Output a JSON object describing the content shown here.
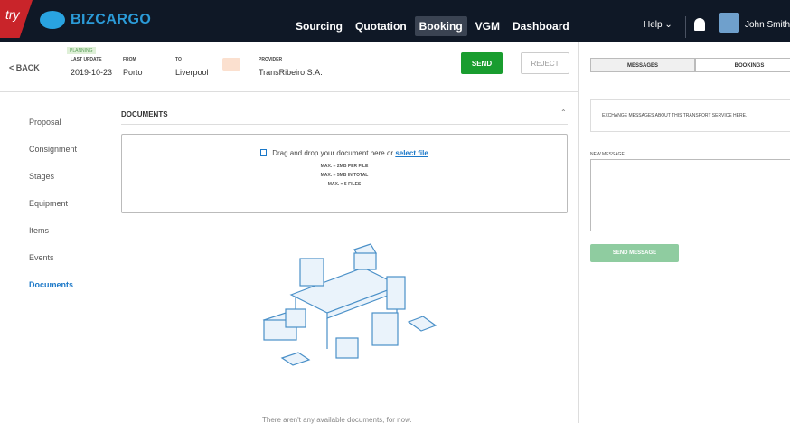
{
  "nav": {
    "try": "try",
    "brand": "BIZCARGO",
    "items": [
      "Sourcing",
      "Quotation",
      "Booking",
      "VGM",
      "Dashboard"
    ],
    "active": "Booking",
    "help": "Help",
    "user": "John Smith"
  },
  "info": {
    "back": "BACK",
    "status": "PLANNING",
    "last_update_label": "LAST UPDATE",
    "last_update": "2019-10-23",
    "from_label": "FROM",
    "from": "Porto",
    "to_label": "TO",
    "to": "Liverpool",
    "provider_label": "PROVIDER",
    "provider": "TransRibeiro S.A.",
    "send": "SEND",
    "reject": "REJECT"
  },
  "sidebar": [
    "Proposal",
    "Consignment",
    "Stages",
    "Equipment",
    "Items",
    "Events",
    "Documents"
  ],
  "sidebar_active": "Documents",
  "documents": {
    "title": "DOCUMENTS",
    "drop_text": "Drag and drop your document here or",
    "select": "select file",
    "limits": [
      "MAX. = 2MB PER FILE",
      "MAX. = 5MB IN TOTAL",
      "MAX. = 5 FILES"
    ],
    "empty": "There aren't any available documents, for now."
  },
  "right": {
    "tabs": [
      "MESSAGES",
      "BOOKINGS"
    ],
    "exchange": "EXCHANGE MESSAGES ABOUT THIS TRANSPORT SERVICE HERE.",
    "new_message": "NEW MESSAGE",
    "send_message": "SEND MESSAGE"
  },
  "colors": {
    "nav": "#0f1826",
    "accent": "#1b78c8",
    "send": "#199d2f"
  }
}
